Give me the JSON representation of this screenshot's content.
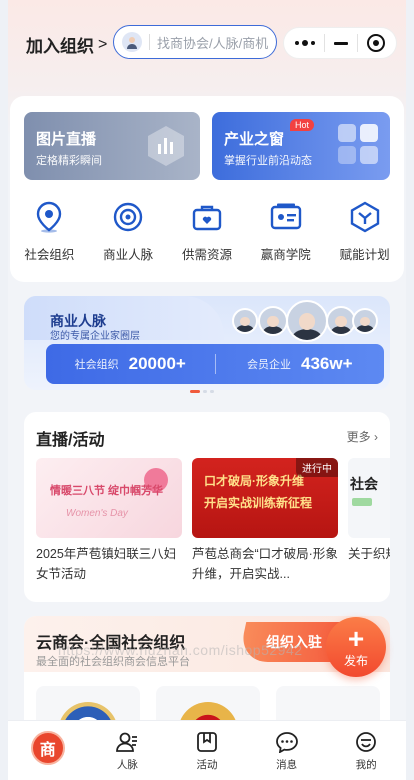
{
  "header": {
    "join_org_label": "加入组织",
    "search_placeholder": "找商协会/人脉/商机"
  },
  "banners": [
    {
      "title": "图片直播",
      "subtitle": "定格精彩瞬间"
    },
    {
      "title": "产业之窗",
      "subtitle": "掌握行业前沿动态",
      "badge": "Hot"
    }
  ],
  "quick_nav": [
    {
      "label": "社会组织",
      "icon": "location-pin-icon"
    },
    {
      "label": "商业人脉",
      "icon": "target-icon"
    },
    {
      "label": "供需资源",
      "icon": "briefcase-heart-icon"
    },
    {
      "label": "赢商学院",
      "icon": "id-card-icon"
    },
    {
      "label": "赋能计划",
      "icon": "hexagon-check-icon"
    }
  ],
  "network": {
    "title": "商业人脉",
    "subtitle": "您的专属企业家圈层",
    "stats": [
      {
        "label": "社会组织",
        "value": "20000+"
      },
      {
        "label": "会员企业",
        "value": "436w+"
      }
    ]
  },
  "activities": {
    "title": "直播/活动",
    "more": "更多",
    "items": [
      {
        "caption": "2025年芦苞镇妇联三八妇女节活动",
        "image_text_1": "情暖三八节 绽巾帼芳华",
        "image_text_2": "Women's Day"
      },
      {
        "caption": "芦苞总商会“口才破局·形象升维，开启实战...",
        "image_text_1": "口才破局·形象升维",
        "image_text_2": "开启实战训练新征程",
        "tag": "进行中"
      },
      {
        "caption": "关于织规",
        "image_text_1": "社会"
      }
    ]
  },
  "orgs": {
    "title": "云商会·全国社会组织",
    "subtitle": "最全面的社会组织商会信息平台",
    "join_button": "组织入驻",
    "watermark": "https://www.huzhan.com/ishop52942"
  },
  "fab": {
    "label": "发布"
  },
  "tabbar": [
    {
      "label": "",
      "logo": "商"
    },
    {
      "label": "人脉"
    },
    {
      "label": "活动"
    },
    {
      "label": "消息"
    },
    {
      "label": "我的"
    }
  ]
}
